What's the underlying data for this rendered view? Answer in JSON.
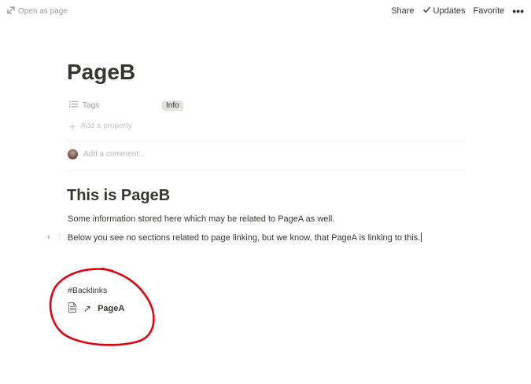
{
  "topbar": {
    "open_as_page": "Open as page",
    "share": "Share",
    "updates": "Updates",
    "favorite": "Favorite",
    "more": "•••"
  },
  "page": {
    "title": "PageB",
    "properties": {
      "tags_label": "Tags",
      "tags_value": "Info",
      "add_property": "Add a property"
    },
    "comment_placeholder": "Add a comment..."
  },
  "content": {
    "heading": "This is PageB",
    "paragraphs": [
      "Some information stored here which may be related to PageA as well.",
      "Below you see no sections related to page linking, but we know, that PageA is linking to this."
    ],
    "backlinks_label": "#Backlinks",
    "backlink": {
      "arrow": "↗",
      "title": "PageA"
    }
  },
  "colors": {
    "annotation": "#e3000f",
    "tag_bg": "#e3e2e0",
    "text": "#37352f",
    "muted": "#9b9a97"
  }
}
